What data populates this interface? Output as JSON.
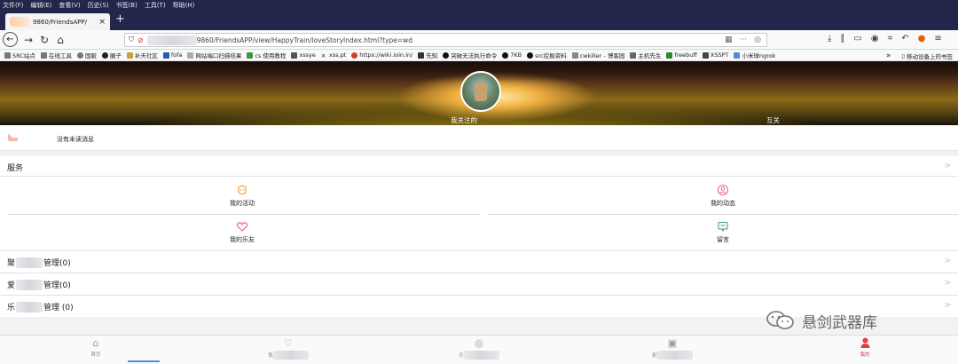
{
  "browser": {
    "menu": [
      "文件(F)",
      "编辑(E)",
      "查看(V)",
      "历史(S)",
      "书签(B)",
      "工具(T)",
      "帮助(H)"
    ],
    "tab_title": "9860/FriendsAPP/",
    "tab_close": "×",
    "new_tab": "+",
    "url": "9860/FriendsAPP/view/HappyTrain/loveStoryIndex.html?type=wd",
    "window_controls": [
      "–",
      "❐",
      "✕"
    ],
    "toolbar_icons": [
      "download-icon",
      "library-icon",
      "sidebar-icon",
      "account-icon",
      "screenshot-icon",
      "undo-icon",
      "firefox-icon",
      "menu-icon"
    ],
    "bookmarks": [
      "SRC站点",
      "在线工具",
      "国服",
      "圈子",
      "补天社区",
      "fofa",
      "网站端口扫描结果",
      "cs 使用教程",
      "xssye",
      "xss.pt",
      "https://wiki.ioin.in/",
      "先知",
      "突破无法执行命令",
      "7KB",
      "src挖掘资料",
      "cwkiller - 博客园",
      "主机先生",
      "freebuff",
      "XSSPT",
      "小米球ngrok"
    ],
    "bookmarks_more": "»",
    "mobile_bookmarks": "移动设备上的书签"
  },
  "header": {
    "following_label": "我关注的",
    "mutual_label": "互关"
  },
  "message": {
    "text": "没有未读消息"
  },
  "services": {
    "title": "服务",
    "items": [
      {
        "label": "我的活动",
        "icon": "activity-icon"
      },
      {
        "label": "我的动态",
        "icon": "profile-circle-icon"
      },
      {
        "label": "我的乐友",
        "icon": "heart-icon"
      },
      {
        "label": "留言",
        "icon": "chat-icon"
      }
    ]
  },
  "management": [
    {
      "prefix": "聚",
      "suffix": "管理(0)"
    },
    {
      "prefix": "爱",
      "suffix": "管理(0)"
    },
    {
      "prefix": "乐",
      "suffix": "管理 (0)"
    }
  ],
  "chevron": ">",
  "watermark": {
    "text": "悬剑武器库"
  },
  "bottom_nav": [
    {
      "label": "首页",
      "icon": "home-icon"
    },
    {
      "label": "我",
      "icon": "heart-outline-icon"
    },
    {
      "label": "乐",
      "icon": "target-icon"
    },
    {
      "label": "配",
      "icon": "image-icon"
    },
    {
      "label": "我的",
      "icon": "user-icon"
    }
  ],
  "colors": {
    "browser_chrome": "#22264a",
    "active_tab": "#e04040",
    "accent_orange": "#f0a030",
    "accent_pink": "#e86a8a",
    "accent_green": "#4aa070"
  }
}
